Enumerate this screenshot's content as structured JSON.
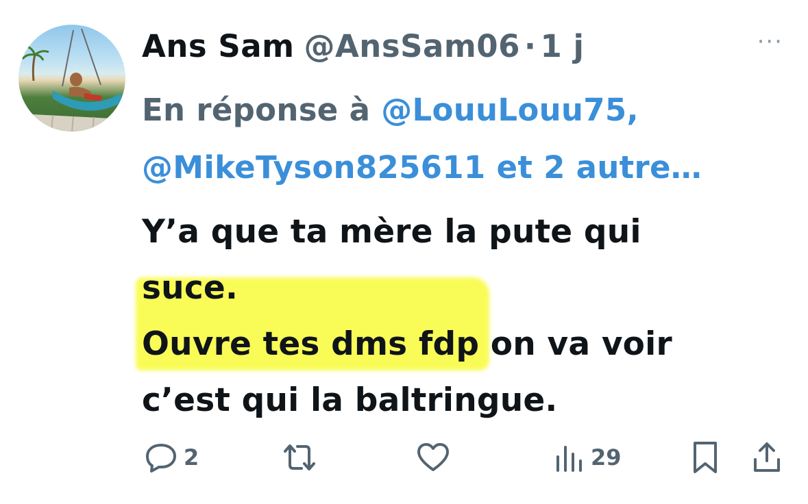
{
  "tweet": {
    "author_name": "Ans Sam",
    "author_handle": "@AnsSam06",
    "separator": "·",
    "time": "1 j",
    "more_label": "···",
    "reply_prefix": "En réponse à",
    "reply_mention_1": "@LouuLouu75,",
    "reply_mention_2": "@MikeTyson825611 et 2 autre…",
    "body_lines": [
      "Y’a que ta mère la pute qui",
      "suce.",
      "Ouvre tes dms fdp on va voir",
      "c’est qui la baltringue."
    ],
    "highlight_color": "#f9fb3a"
  },
  "actions": {
    "reply_icon": "reply-icon",
    "reply_count": "2",
    "retweet_icon": "retweet-icon",
    "like_icon": "heart-icon",
    "views_icon": "views-icon",
    "views_count": "29",
    "bookmark_icon": "bookmark-icon",
    "share_icon": "share-icon"
  },
  "colors": {
    "text": "#0f1419",
    "muted": "#536471",
    "link": "#3b8fd9"
  }
}
